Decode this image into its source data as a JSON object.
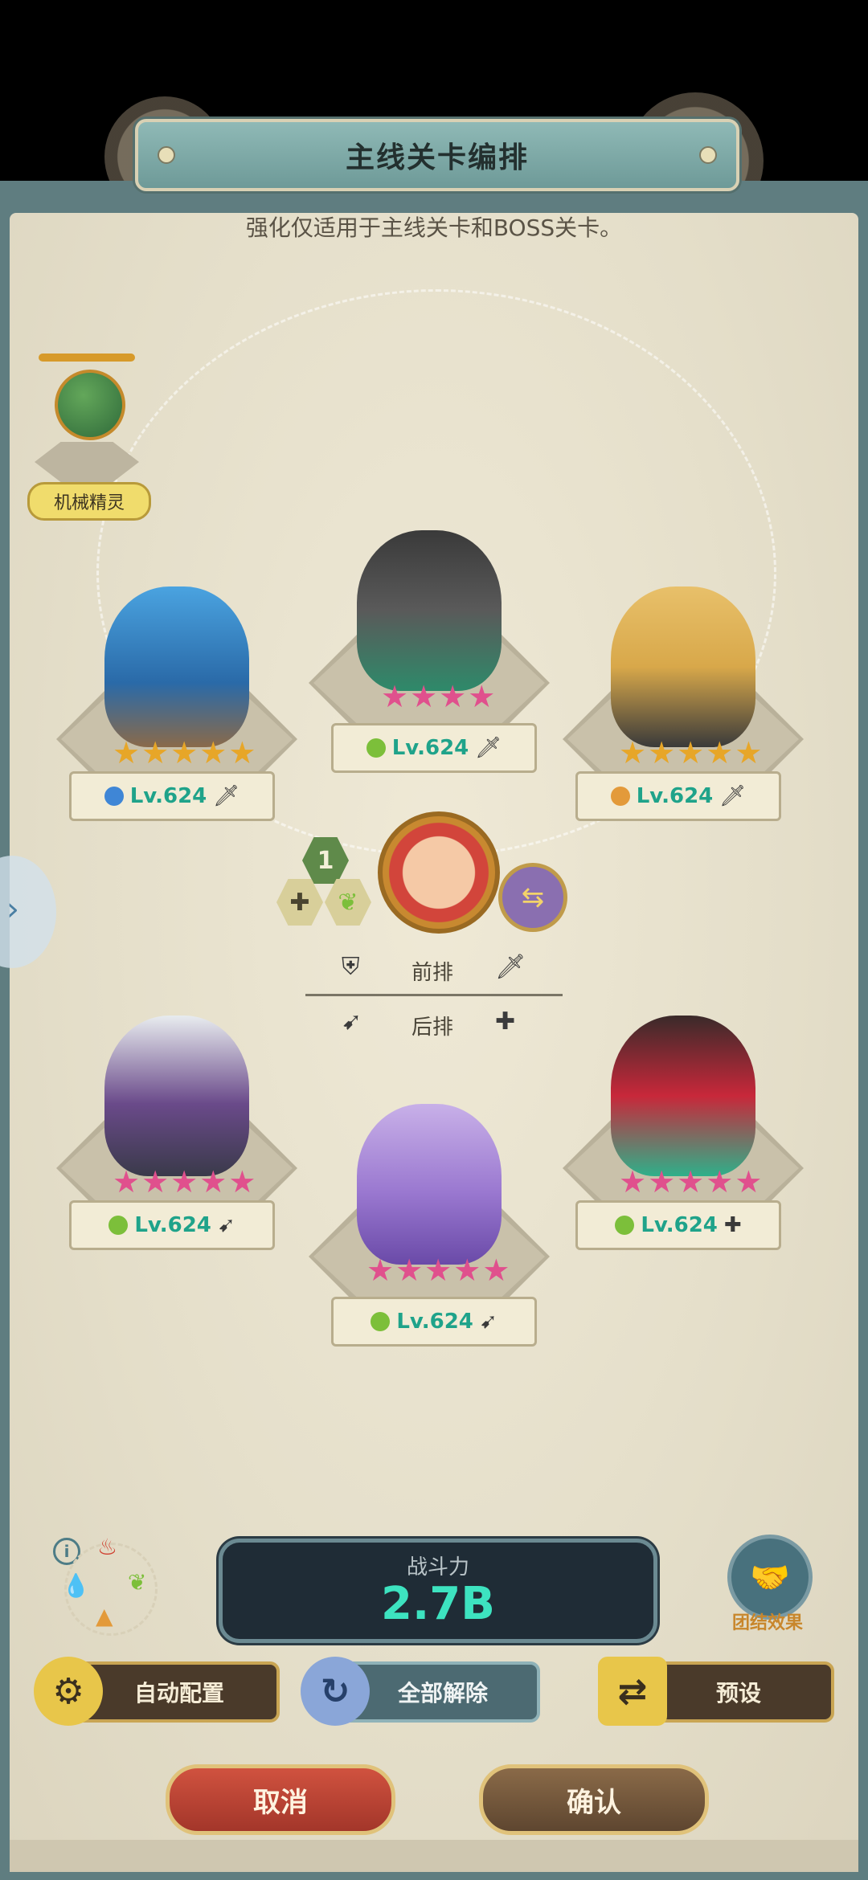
{
  "title": "主线关卡编排",
  "subtitle": "强化仅适用于主线关卡和BOSS关卡。",
  "spirit_label": "机械精灵",
  "rows": {
    "front": "前排",
    "back": "后排"
  },
  "leader": {
    "badge": "1"
  },
  "heroes": [
    {
      "name": "hero-1",
      "stars": 5,
      "star_color": "#e7a628",
      "element": "water",
      "element_color": "#3f86d6",
      "level": "Lv.624",
      "cls_icon": "sword-icon",
      "cls": "🗡"
    },
    {
      "name": "hero-2",
      "stars": 4,
      "star_color": "#e0508d",
      "element": "wind",
      "element_color": "#7cbf3a",
      "level": "Lv.624",
      "cls_icon": "sword-icon",
      "cls": "🗡"
    },
    {
      "name": "hero-3",
      "stars": 5,
      "star_color": "#e7a628",
      "element": "fire",
      "element_color": "#e39a3a",
      "level": "Lv.624",
      "cls_icon": "sword-icon",
      "cls": "🗡"
    },
    {
      "name": "hero-4",
      "stars": 5,
      "star_color": "#e0508d",
      "element": "wind",
      "element_color": "#7cbf3a",
      "level": "Lv.624",
      "cls_icon": "bow-icon",
      "cls": "➹"
    },
    {
      "name": "hero-5",
      "stars": 5,
      "star_color": "#e0508d",
      "element": "wind",
      "element_color": "#7cbf3a",
      "level": "Lv.624",
      "cls_icon": "bow-icon",
      "cls": "➹"
    },
    {
      "name": "hero-6",
      "stars": 5,
      "star_color": "#e0508d",
      "element": "wind",
      "element_color": "#7cbf3a",
      "level": "Lv.624",
      "cls_icon": "healer-icon",
      "cls": "✚"
    }
  ],
  "power": {
    "label": "战斗力",
    "value": "2.7B"
  },
  "unity_label": "团结效果",
  "buttons": {
    "auto": "自动配置",
    "clear": "全部解除",
    "preset": "预设",
    "cancel": "取消",
    "confirm": "确认"
  }
}
